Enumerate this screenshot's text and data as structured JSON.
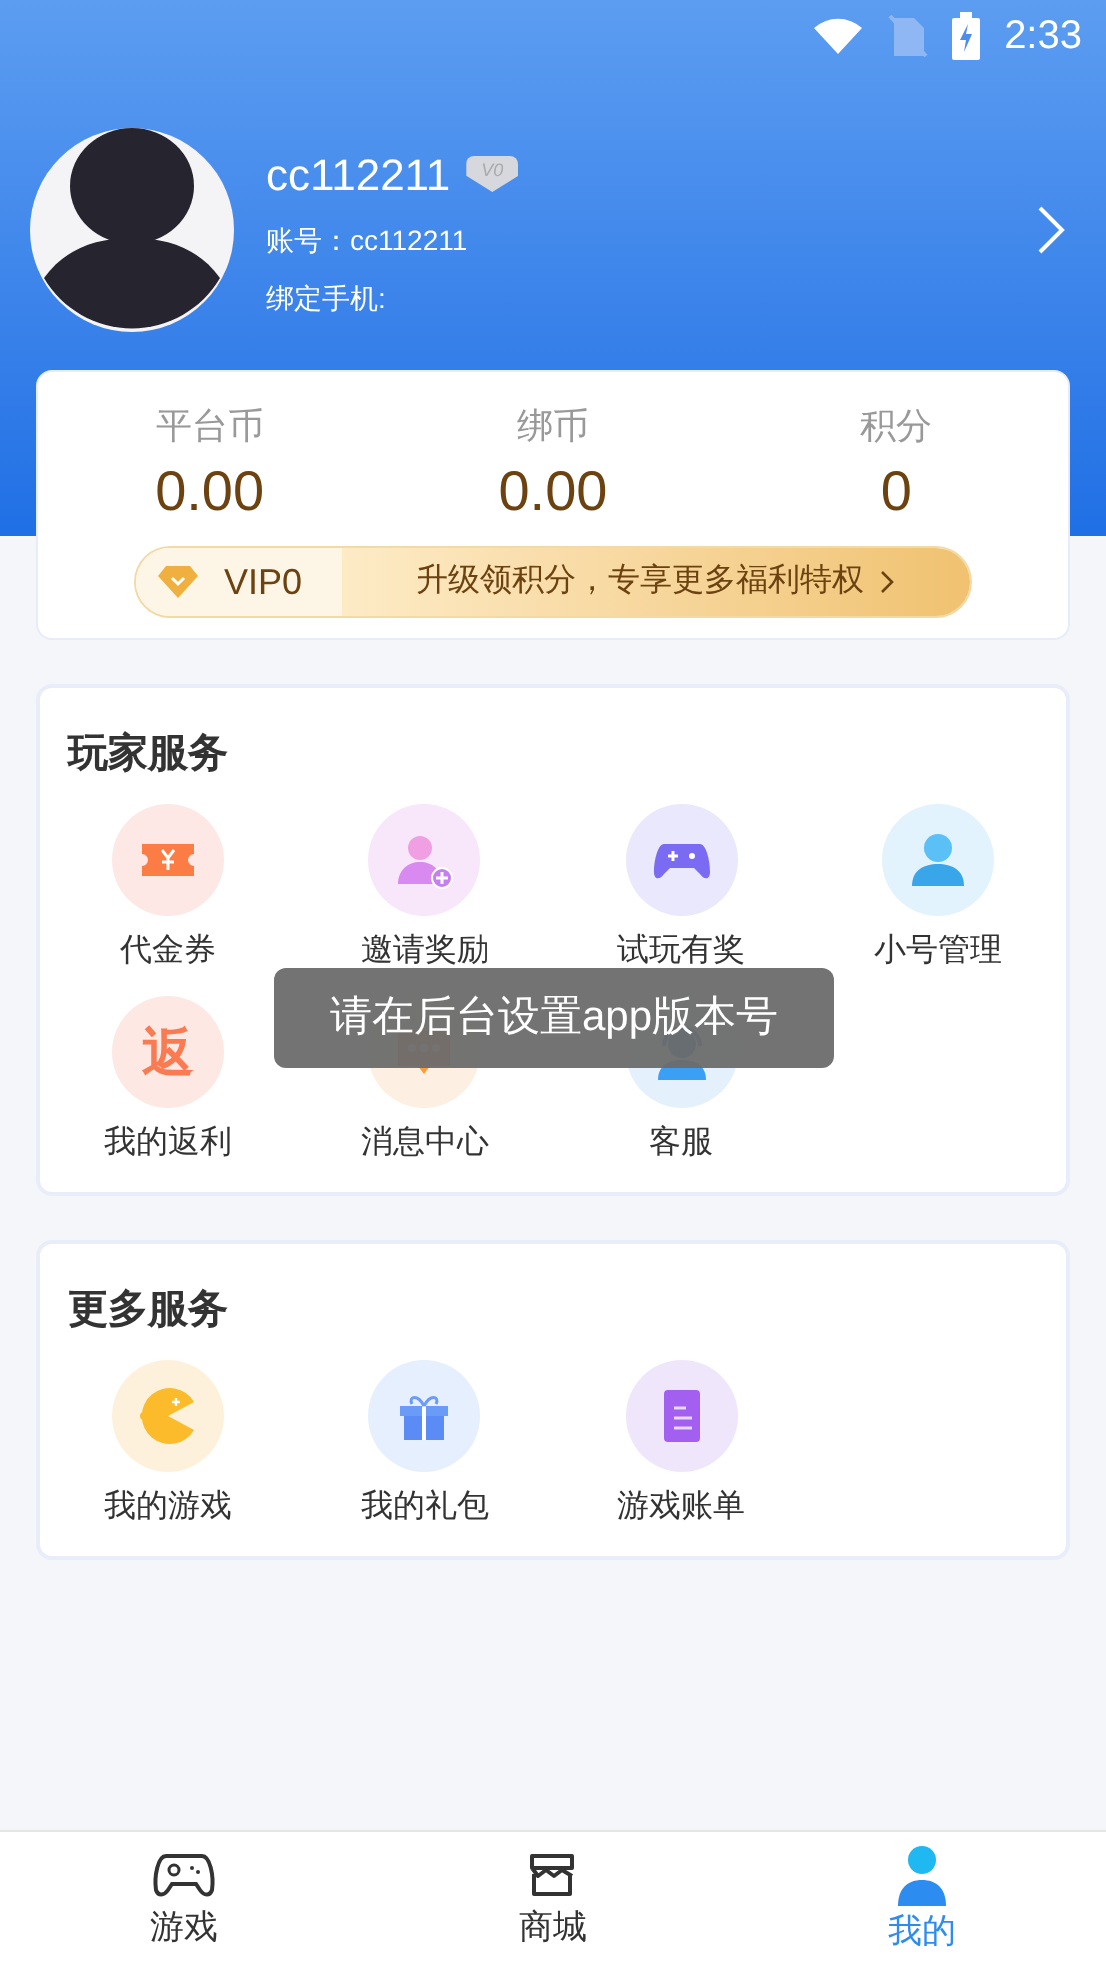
{
  "status_bar": {
    "time": "2:33"
  },
  "profile": {
    "username": "cc112211",
    "level_badge": "V0",
    "account": "账号：cc112211",
    "phone": "绑定手机:"
  },
  "balances": [
    {
      "label": "平台币",
      "value": "0.00"
    },
    {
      "label": "绑币",
      "value": "0.00"
    },
    {
      "label": "积分",
      "value": "0"
    }
  ],
  "vip": {
    "level": "VIP0",
    "promo": "升级领积分，专享更多福利特权"
  },
  "sections": [
    {
      "title": "玩家服务",
      "items": [
        {
          "label": "代金券"
        },
        {
          "label": "邀请奖励"
        },
        {
          "label": "试玩有奖"
        },
        {
          "label": "小号管理"
        },
        {
          "label": "我的返利",
          "glyph": "返"
        },
        {
          "label": "消息中心"
        },
        {
          "label": "客服"
        }
      ]
    },
    {
      "title": "更多服务",
      "items": [
        {
          "label": "我的游戏"
        },
        {
          "label": "我的礼包"
        },
        {
          "label": "游戏账单"
        }
      ]
    }
  ],
  "toast": {
    "text": "请在后台设置app版本号"
  },
  "tab_bar": [
    {
      "label": "游戏",
      "selected": false
    },
    {
      "label": "商城",
      "selected": false
    },
    {
      "label": "我的",
      "selected": true
    }
  ]
}
